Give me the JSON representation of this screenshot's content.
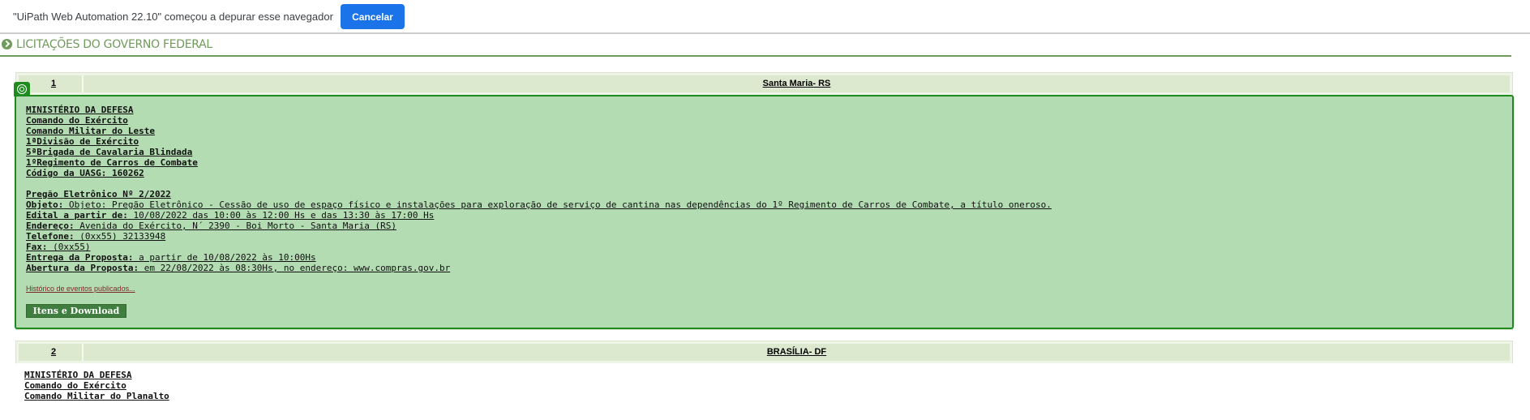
{
  "infobar": {
    "message": "\"UiPath Web Automation 22.10\" começou a depurar esse navegador",
    "cancel_label": "Cancelar"
  },
  "page": {
    "section_title": "LICITAÇÕES DO GOVERNO FEDERAL"
  },
  "records": [
    {
      "number": "1",
      "city": "Santa Maria- RS",
      "org_lines": [
        "MINISTÉRIO DA DEFESA",
        "Comando do Exército",
        "Comando Militar do Leste",
        "1ªDivisão de Exército",
        "5ªBrigada de Cavalaria Blindada",
        "1ºRegimento de Carros de Combate",
        "Código da UASG: 160262"
      ],
      "pregao": "Pregão Eletrônico Nº 2/2022",
      "fields": [
        {
          "label": "Objeto:",
          "value": " Objeto: Pregão Eletrônico - Cessão de uso de espaço físico e instalações para exploração de serviço de cantina nas dependências do 1º Regimento de Carros de Combate, a título oneroso."
        },
        {
          "label": "Edital a partir de:",
          "value": " 10/08/2022 das 10:00 às 12:00 Hs e das 13:30 às 17:00 Hs"
        },
        {
          "label": "Endereço:",
          "value": " Avenida do Exército, N´ 2390 - Boi Morto - Santa Maria (RS)"
        },
        {
          "label": "Telefone:",
          "value": " (0xx55) 32133948"
        },
        {
          "label": "Fax:",
          "value": " (0xx55)"
        },
        {
          "label": "Entrega da Proposta:",
          "value": "  a partir de 10/08/2022 às 10:00Hs"
        },
        {
          "label": "Abertura da Proposta:",
          "value": "  em 22/08/2022 às 08:30Hs, no endereço: www.compras.gov.br"
        }
      ],
      "history_link": "Histórico de eventos publicados...",
      "download_label": "Itens e Download"
    },
    {
      "number": "2",
      "city": "BRASÍLIA- DF",
      "org_lines": [
        "MINISTÉRIO DA DEFESA",
        "Comando do Exército",
        "Comando Militar do Planalto"
      ]
    }
  ]
}
